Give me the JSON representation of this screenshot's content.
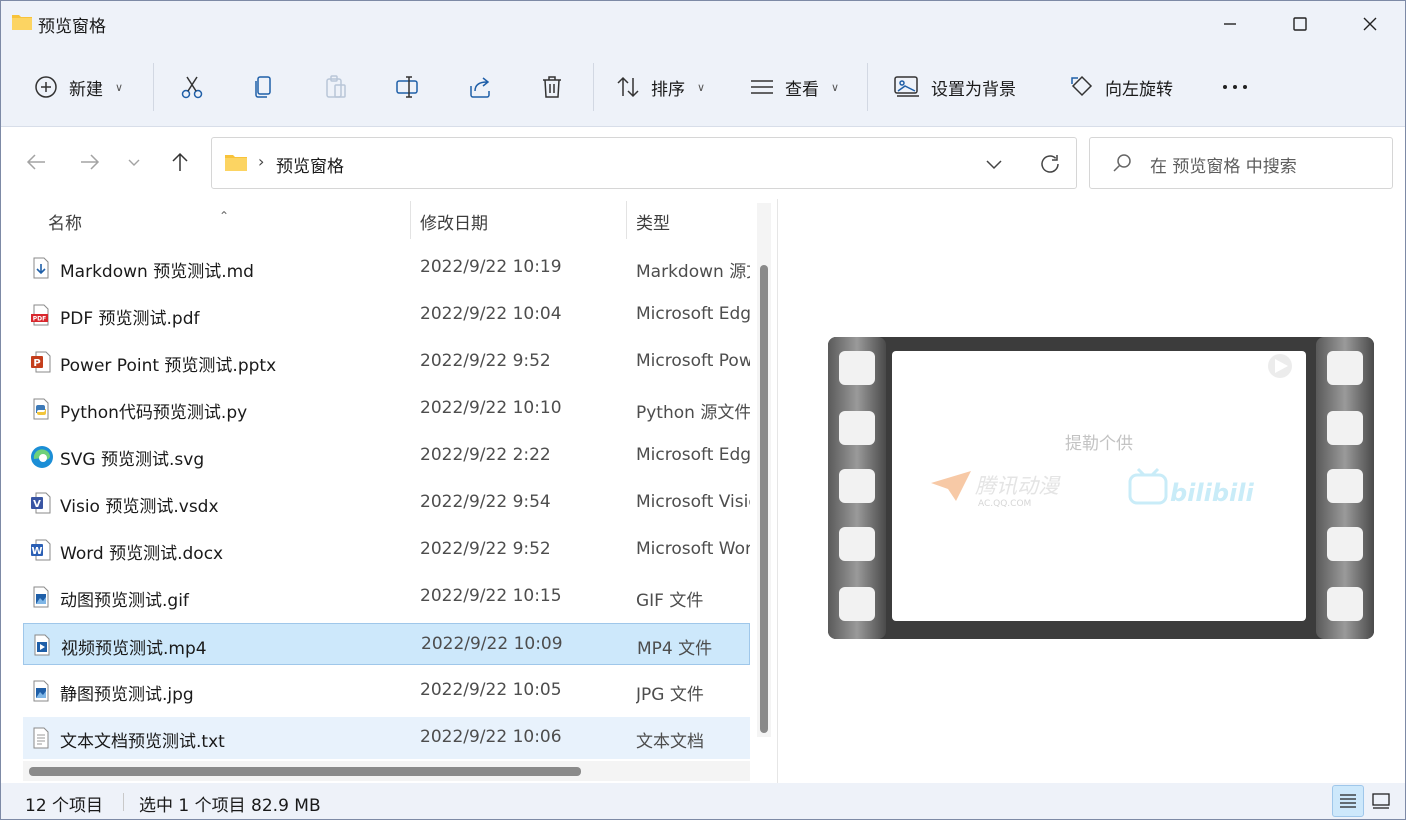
{
  "window": {
    "title": "预览窗格"
  },
  "toolbar": {
    "new_label": "新建",
    "sort_label": "排序",
    "view_label": "查看",
    "set_bg_label": "设置为背景",
    "rotate_left_label": "向左旋转"
  },
  "address": {
    "crumb": "预览窗格"
  },
  "search": {
    "placeholder": "在 预览窗格 中搜索"
  },
  "columns": {
    "name": "名称",
    "date": "修改日期",
    "type": "类型"
  },
  "files": [
    {
      "name": "Markdown 预览测试.md",
      "date": "2022/9/22 10:19",
      "type": "Markdown 源文件",
      "icon": "markdown-file-icon"
    },
    {
      "name": "PDF 预览测试.pdf",
      "date": "2022/9/22 10:04",
      "type": "Microsoft Edge PDF",
      "icon": "pdf-file-icon"
    },
    {
      "name": "Power Point 预览测试.pptx",
      "date": "2022/9/22 9:52",
      "type": "Microsoft PowerPoint",
      "icon": "powerpoint-file-icon"
    },
    {
      "name": "Python代码预览测试.py",
      "date": "2022/9/22 10:10",
      "type": "Python 源文件",
      "icon": "python-file-icon"
    },
    {
      "name": "SVG 预览测试.svg",
      "date": "2022/9/22 2:22",
      "type": "Microsoft Edge HTML",
      "icon": "edge-svg-file-icon"
    },
    {
      "name": "Visio 预览测试.vsdx",
      "date": "2022/9/22 9:54",
      "type": "Microsoft Visio",
      "icon": "visio-file-icon"
    },
    {
      "name": "Word 预览测试.docx",
      "date": "2022/9/22 9:52",
      "type": "Microsoft Word",
      "icon": "word-file-icon"
    },
    {
      "name": "动图预览测试.gif",
      "date": "2022/9/22 10:15",
      "type": "GIF 文件",
      "icon": "image-file-icon"
    },
    {
      "name": "视频预览测试.mp4",
      "date": "2022/9/22 10:09",
      "type": "MP4 文件",
      "icon": "video-file-icon"
    },
    {
      "name": "静图预览测试.jpg",
      "date": "2022/9/22 10:05",
      "type": "JPG 文件",
      "icon": "image-file-icon"
    },
    {
      "name": "文本文档预览测试.txt",
      "date": "2022/9/22 10:06",
      "type": "文本文档",
      "icon": "text-file-icon"
    }
  ],
  "selected_index": 8,
  "hover_index": 10,
  "preview": {
    "frame_text": "提勒个供",
    "logo_tencent": "腾讯动漫",
    "logo_tencent_sub": "AC.QQ.COM",
    "logo_bilibili": "bilibili"
  },
  "status": {
    "count": "12 个项目",
    "selection": "选中 1 个项目  82.9 MB"
  },
  "colors": {
    "selected_row": "#cde8fb",
    "accent": "#0067c0",
    "folder": "#f8c33a"
  }
}
